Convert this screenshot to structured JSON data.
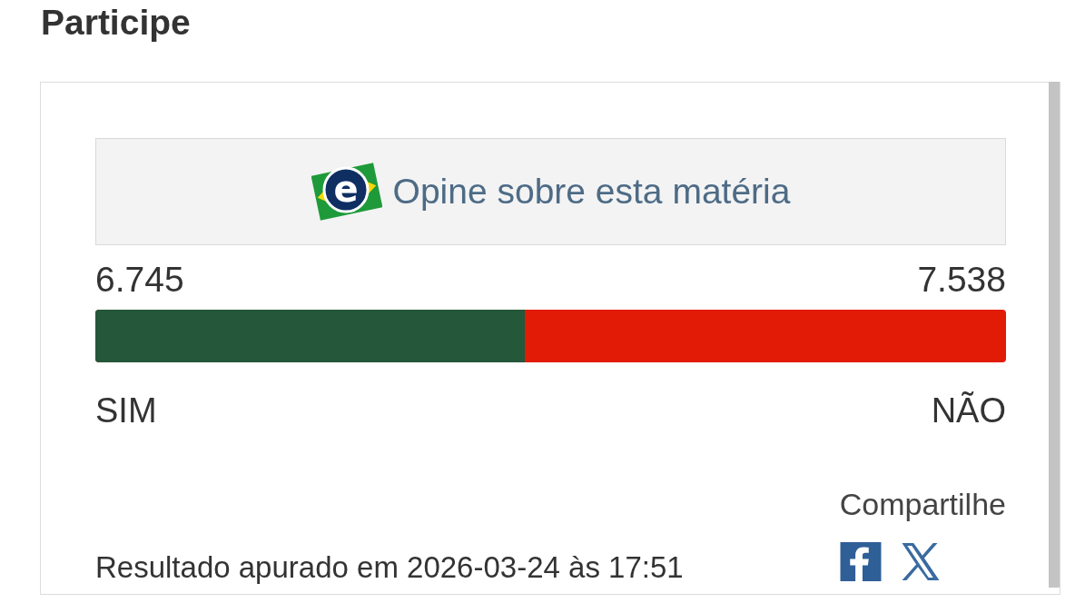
{
  "heading": "Participe",
  "poll": {
    "prompt": {
      "logo_letter": "e",
      "label": "Opine sobre esta matéria"
    },
    "options": [
      {
        "label": "SIM",
        "count": "6.745",
        "color": "#25573a"
      },
      {
        "label": "NÃO",
        "count": "7.538",
        "color": "#e21b07"
      }
    ],
    "bar": {
      "level": 0.472
    },
    "result": "Resultado apurado em 2026-03-24 às 17:51",
    "share": {
      "label": "Compartilhe",
      "links": [
        {
          "kind": "facebook"
        },
        {
          "kind": "x"
        }
      ]
    }
  }
}
